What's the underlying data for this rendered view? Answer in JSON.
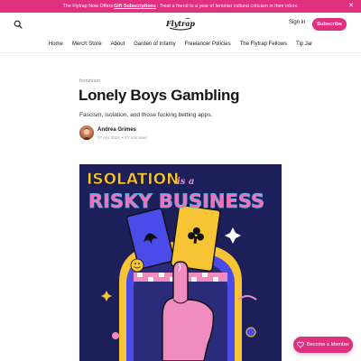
{
  "banner": {
    "text_before": "The Flytrap Now Offers",
    "link": "Gift Subscriptions",
    "text_after": ": Treat a friend to a year of feminist cultural criticism in their inbox.",
    "close_icon": "close-icon"
  },
  "header": {
    "logo": "Flytrap",
    "sign_in": "Sign in",
    "subscribe": "Subscribe",
    "search_icon": "search-icon"
  },
  "nav": {
    "items": [
      "Home",
      "Merch Store",
      "About",
      "Garden of Infamy",
      "Freelancer Policies",
      "The Flytrap Fellows",
      "Tip Jar"
    ]
  },
  "article": {
    "tag": "feminism",
    "title": "Lonely Boys Gambling",
    "subtitle": "Fascism, isolation, and those fucking betting apps.",
    "author": "Andrea Grimes",
    "date": "27 Apr 2026",
    "separator": "•",
    "read_time": "17 min read"
  },
  "hero": {
    "line1_a": "ISOLATION",
    "line1_b": "is a",
    "line2": "RISKY BUSINESS"
  },
  "cta": {
    "label": "Become a Member"
  },
  "colors": {
    "accent": "#e0307f",
    "hero_bg": "#1d1f5a",
    "hero_yellow": "#f7c435",
    "hero_blue": "#4a4be8",
    "hero_pink": "#f08cc0"
  }
}
